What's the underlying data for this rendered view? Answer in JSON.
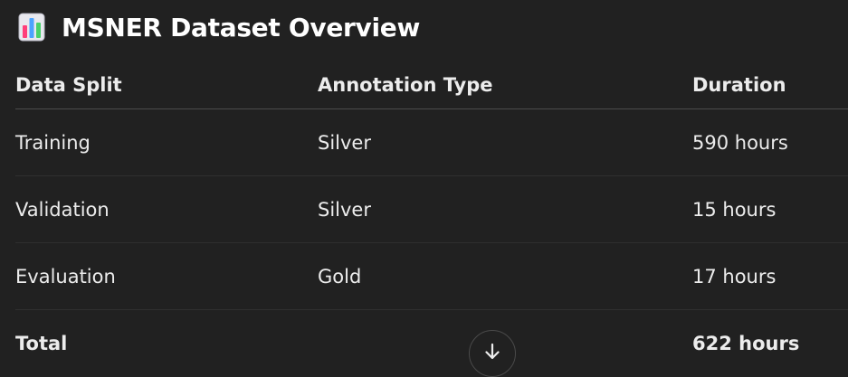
{
  "heading": {
    "icon": "bar-chart-emoji-icon",
    "title": "MSNER Dataset Overview"
  },
  "table": {
    "columns": [
      "Data Split",
      "Annotation Type",
      "Duration"
    ],
    "rows": [
      [
        "Training",
        "Silver",
        "590 hours"
      ],
      [
        "Validation",
        "Silver",
        "15 hours"
      ],
      [
        "Evaluation",
        "Gold",
        "17 hours"
      ]
    ],
    "total": [
      "Total",
      "",
      "622 hours"
    ]
  },
  "scroll_button": {
    "icon": "arrow-down-icon"
  },
  "colors": {
    "background": "#212121",
    "text": "#ececec",
    "divider": "#2f2f2f"
  }
}
